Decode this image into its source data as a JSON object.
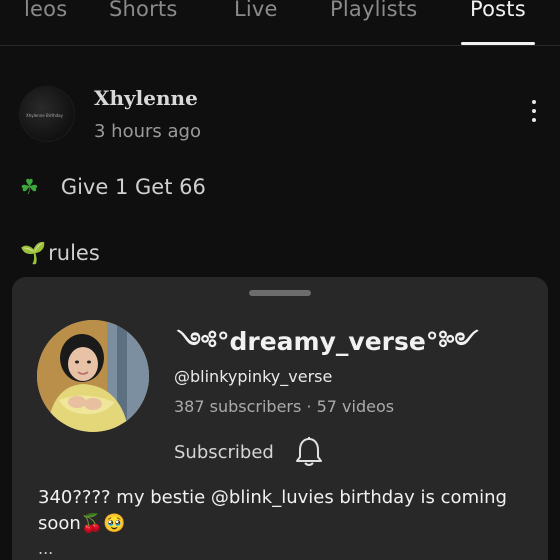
{
  "tabs": [
    {
      "label": "leos",
      "active": false
    },
    {
      "label": "Shorts",
      "active": false
    },
    {
      "label": "Live",
      "active": false
    },
    {
      "label": "Playlists",
      "active": false
    },
    {
      "label": "Posts",
      "active": true
    }
  ],
  "post": {
    "author": "Xhylenne",
    "time": "3 hours ago",
    "avatar_text": "Xhylenne Birthday",
    "line1_emoji": "☘",
    "line1_text": "Give 1 Get 66",
    "line2_emoji": "🌱",
    "line2_text": "rules"
  },
  "sheet": {
    "channel_name": "༺°dreamy_verse°༻",
    "handle": "@blinkypinky_verse",
    "stats": "387 subscribers · 57 videos",
    "subscribed_label": "Subscribed",
    "post_text": "340???? my bestie @blink_luvies birthday is coming soon🍒🥹",
    "ellipsis": "..."
  },
  "colors": {
    "background": "#0f0f0f",
    "sheet": "#282828",
    "active_tab": "#f1f1f1",
    "inactive_tab": "#8a8a8a"
  }
}
